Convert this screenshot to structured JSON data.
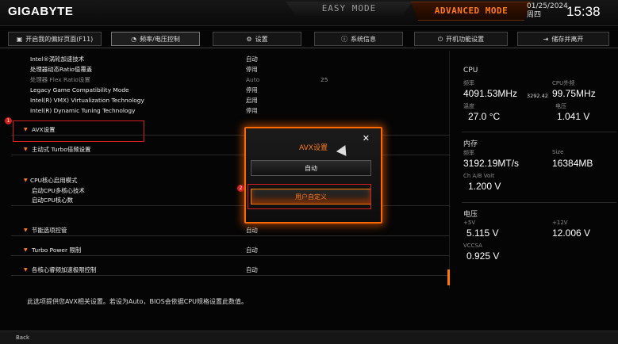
{
  "header": {
    "logo": "GIGABYTE",
    "easy_mode": "EASY MODE",
    "advanced_mode": "ADVANCED MODE",
    "date": "01/25/2024",
    "weekday": "周四",
    "time": "15:38"
  },
  "tabs": [
    {
      "label": "开启我的偏好页面(F11)",
      "icon": "favorite-icon"
    },
    {
      "label": "频率/电压控制",
      "icon": "speedometer-icon"
    },
    {
      "label": "设置",
      "icon": "settings-icon"
    },
    {
      "label": "系统信息",
      "icon": "info-icon"
    },
    {
      "label": "开机功能设置",
      "icon": "power-icon"
    },
    {
      "label": "储存并离开",
      "icon": "exit-icon"
    }
  ],
  "settings": [
    {
      "label": "Intel®涡轮加速技术",
      "value": "自动"
    },
    {
      "label": "处理器动态Ratio值覆盖",
      "value": "停用"
    },
    {
      "label": "处理器 Flex Ratio设置",
      "value": "Auto",
      "value2": "25"
    },
    {
      "label": "Legacy Game Compatibility Mode",
      "value": "停用"
    },
    {
      "label": "Intel(R) VMX) Virtualization Technology",
      "value": "启用"
    },
    {
      "label": "Intel(R) Dynamic Tuning Technology",
      "value": "停用"
    },
    {
      "label": "AVX设置",
      "value": ""
    },
    {
      "label": "主动式 Turbo倍频设置",
      "value": ""
    },
    {
      "label": "CPU核心启用模式",
      "value": ""
    },
    {
      "label": "启动CPU多核心技术",
      "value": ""
    },
    {
      "label": "启动CPU核心数",
      "value": ""
    },
    {
      "label": "节能选项控管",
      "value": "自动"
    },
    {
      "label": "Turbo Power 限制",
      "value": "自动"
    },
    {
      "label": "各核心睿频加速极限控制",
      "value": "自动"
    }
  ],
  "description": "此选项提供您AVX相关设置。若设为Auto，BIOS会依据CPU规格设置此数值。",
  "bottom": {
    "back": "Back"
  },
  "badges": {
    "one": "1",
    "two": "2"
  },
  "dialog": {
    "title": "AVX设置",
    "close": "✕",
    "option_auto": "自动",
    "option_custom": "用户自定义"
  },
  "monitor": {
    "cpu": {
      "header": "CPU",
      "freq_label": "频率",
      "freq_value": "4091.53MHz",
      "freq_extra": "3292.42",
      "bclk_label": "CPU外频",
      "bclk_value": "99.75MHz",
      "temp_label": "温度",
      "temp_value": "27.0 °C",
      "volt_label": "电压",
      "volt_value": "1.041 V"
    },
    "memory": {
      "header": "内存",
      "freq_label": "频率",
      "freq_value": "3192.19MT/s",
      "size_label": "Size",
      "size_value": "16384MB",
      "volt_label": "Ch A/B Volt",
      "volt_value": "1.200 V"
    },
    "voltage": {
      "header": "电压",
      "v5_label": "+5V",
      "v5_value": "5.115 V",
      "v12_label": "+12V",
      "v12_value": "12.006 V",
      "vccsa_label": "VCCSA",
      "vccsa_value": "0.925 V"
    }
  },
  "colors": {
    "accent": "#ff7a1a",
    "highlight_box": "#d52020",
    "background": "#050505"
  }
}
